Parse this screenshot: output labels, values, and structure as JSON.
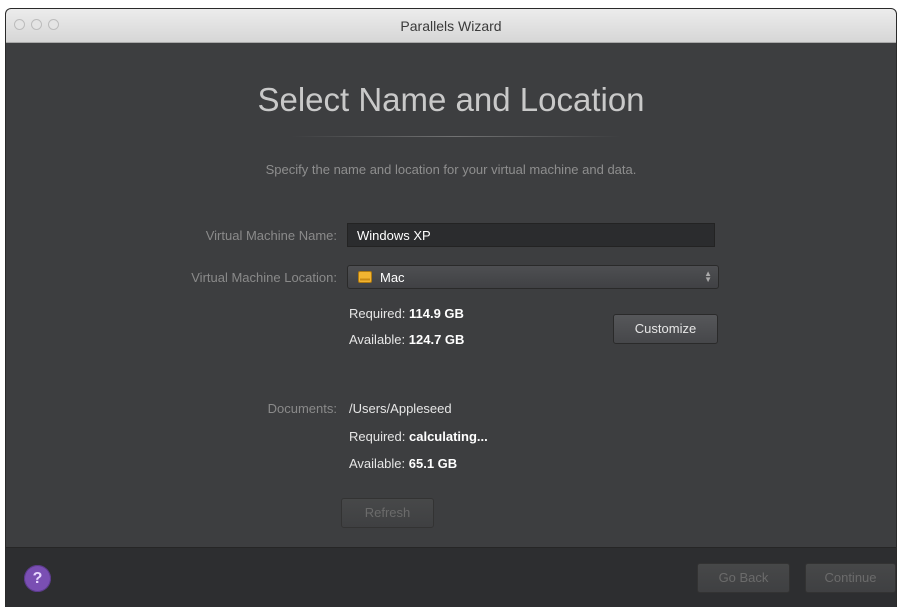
{
  "window": {
    "title": "Parallels Wizard"
  },
  "page": {
    "heading": "Select Name and Location",
    "subtitle": "Specify the name and location for your virtual machine and data."
  },
  "form": {
    "vm_name_label": "Virtual Machine Name:",
    "vm_name_value": "Windows XP",
    "vm_location_label": "Virtual Machine Location:",
    "vm_location_value": "Mac",
    "vm_required_label": "Required:",
    "vm_required_value": "114.9 GB",
    "vm_available_label": "Available:",
    "vm_available_value": "124.7 GB",
    "customize_label": "Customize",
    "documents_label": "Documents:",
    "documents_path": "/Users/Appleseed",
    "doc_required_label": "Required:",
    "doc_required_value": "calculating...",
    "doc_available_label": "Available:",
    "doc_available_value": "65.1 GB",
    "refresh_label": "Refresh"
  },
  "footer": {
    "help_label": "?",
    "go_back_label": "Go Back",
    "continue_label": "Continue"
  },
  "icons": {
    "drive": "hard-drive-icon",
    "select_arrows": "updown-icon",
    "help": "help-icon"
  },
  "colors": {
    "background": "#3d3e40",
    "help_button": "#7a4fb3",
    "drive_icon": "#f2b431"
  }
}
